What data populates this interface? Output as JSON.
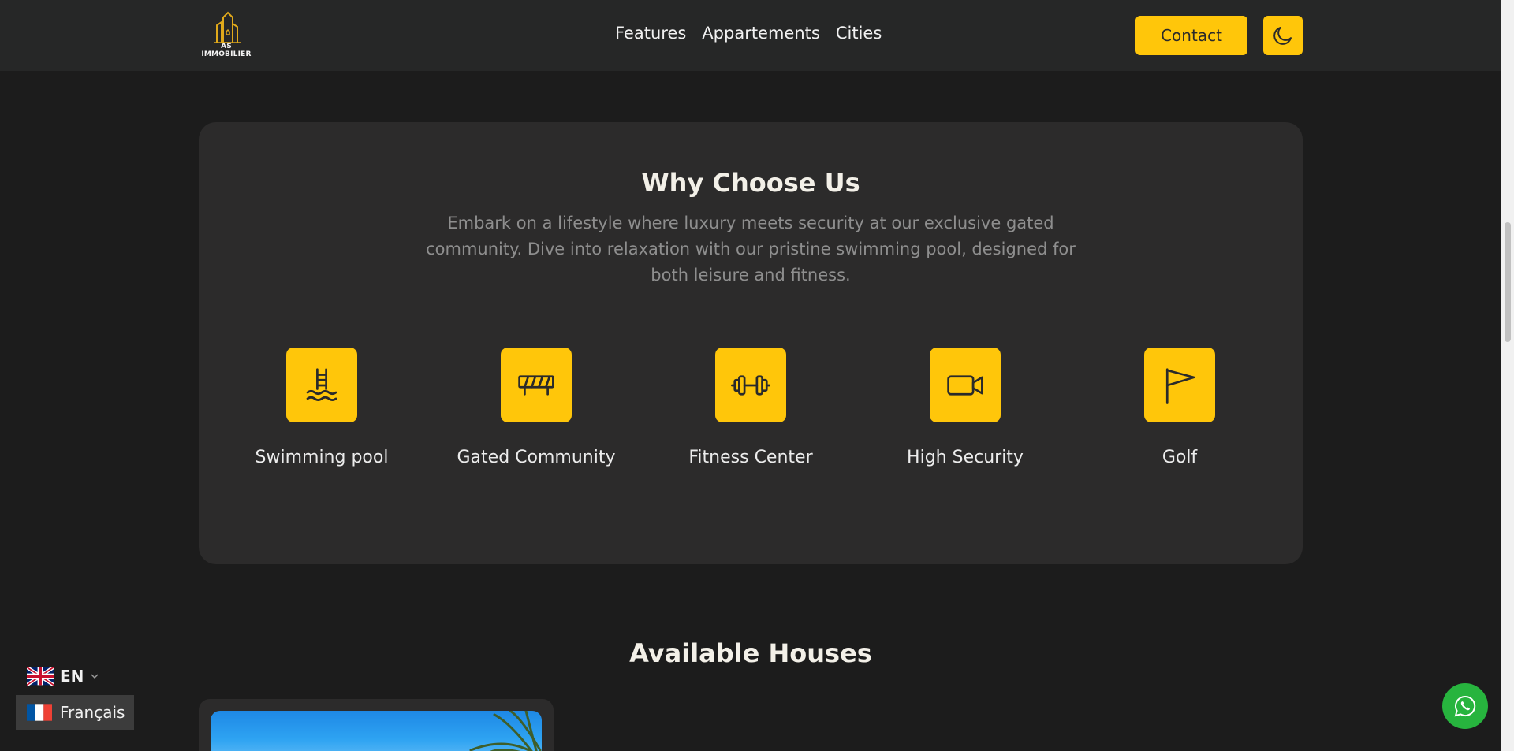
{
  "header": {
    "logo_text": "AS IMMOBILIER",
    "nav": [
      "Features",
      "Appartements",
      "Cities"
    ],
    "contact_label": "Contact",
    "theme_icon": "moon-icon"
  },
  "why": {
    "title": "Why Choose Us",
    "description": "Embark on a lifestyle where luxury meets security at our exclusive gated community. Dive into relaxation with our pristine swimming pool, designed for both leisure and fitness.",
    "features": [
      {
        "label": "Swimming pool",
        "icon": "swimming-pool-icon"
      },
      {
        "label": "Gated Community",
        "icon": "barrier-icon"
      },
      {
        "label": "Fitness Center",
        "icon": "dumbbell-icon"
      },
      {
        "label": "High Security",
        "icon": "video-camera-icon"
      },
      {
        "label": "Golf",
        "icon": "flag-icon"
      }
    ]
  },
  "available": {
    "title": "Available Houses"
  },
  "language": {
    "current": "EN",
    "option": "Français"
  },
  "colors": {
    "accent": "#ffc60a",
    "background": "#1c1c1c",
    "card": "#2c2b2b",
    "whatsapp": "#27b43e"
  }
}
